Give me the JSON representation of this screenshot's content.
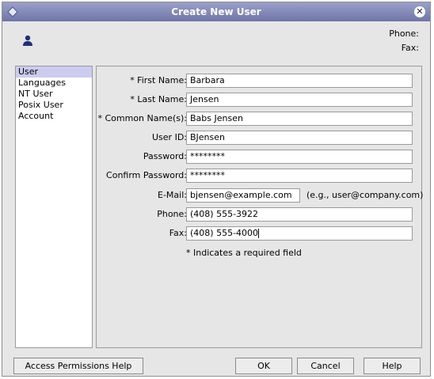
{
  "window": {
    "title": "Create New User"
  },
  "header": {
    "phone_label": "Phone:",
    "fax_label": "Fax:"
  },
  "nav": {
    "items": [
      "User",
      "Languages",
      "NT User",
      "Posix User",
      "Account"
    ],
    "selected": 0
  },
  "form": {
    "first_name": {
      "label": "* First Name:",
      "value": "Barbara"
    },
    "last_name": {
      "label": "* Last Name:",
      "value": "Jensen"
    },
    "common_name": {
      "label": "* Common Name(s):",
      "value": "Babs Jensen"
    },
    "user_id": {
      "label": "User ID:",
      "value": "BJensen"
    },
    "password": {
      "label": "Password:",
      "value": "********"
    },
    "confirm_password": {
      "label": "Confirm Password:",
      "value": "********"
    },
    "email": {
      "label": "E-Mail:",
      "value": "bjensen@example.com",
      "hint": "(e.g., user@company.com)"
    },
    "phone": {
      "label": "Phone:",
      "value": "(408) 555-3922"
    },
    "fax": {
      "label": "Fax:",
      "value": "(408) 555-4000"
    },
    "required_note": "* Indicates a required field"
  },
  "buttons": {
    "access_help": "Access Permissions Help",
    "ok": "OK",
    "cancel": "Cancel",
    "help": "Help"
  },
  "colors": {
    "titlebar": "#7a82b4",
    "selected": "#ccccf0",
    "background": "#e6e6e6"
  }
}
